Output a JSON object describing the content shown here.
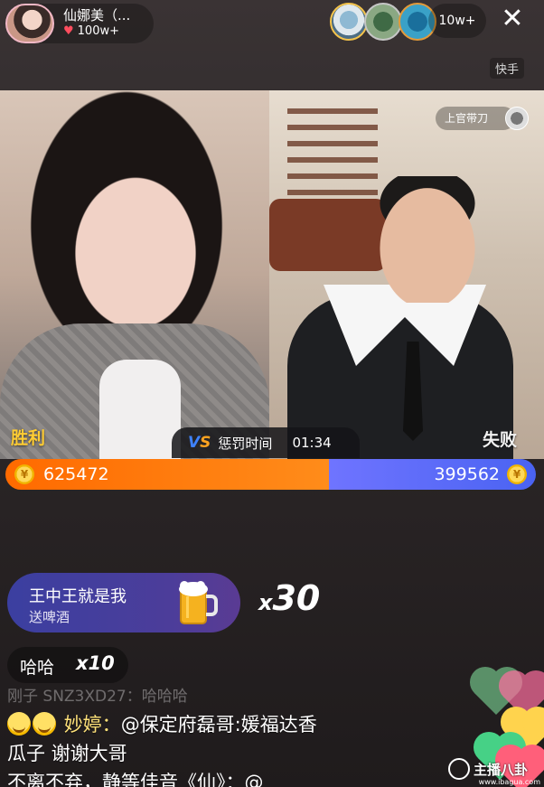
{
  "host": {
    "name": "仙娜美（...",
    "likes": "100w+"
  },
  "viewers": {
    "count": "10w+"
  },
  "brand": {
    "label": "快手"
  },
  "pk": {
    "guest_name": "上官带刀",
    "left_result": "胜利",
    "right_result": "失败",
    "phase_label": "惩罚时间",
    "timer": "01:34",
    "left_score": "625472",
    "right_score": "399562",
    "left_share": 0.61,
    "colors": {
      "left": "#ff7a10",
      "right": "#5a68f5"
    }
  },
  "gift": {
    "sender": "王中王就是我",
    "action": "送啤酒",
    "multiplier_prefix": "x",
    "multiplier": "30"
  },
  "combo": {
    "text": "哈哈",
    "count": "x10"
  },
  "chat": {
    "faded_line": "刚子 SNZ3XD27：哈哈哈",
    "message_user": "妙婷：",
    "message_text": "@保定府磊哥:媛福达香",
    "message_text_2": "瓜子 谢谢大哥",
    "cut_line": "不离不弃，静等佳音《仙》：@"
  },
  "watermark": {
    "text": "主播八卦",
    "url": "www.ibagua.com"
  }
}
